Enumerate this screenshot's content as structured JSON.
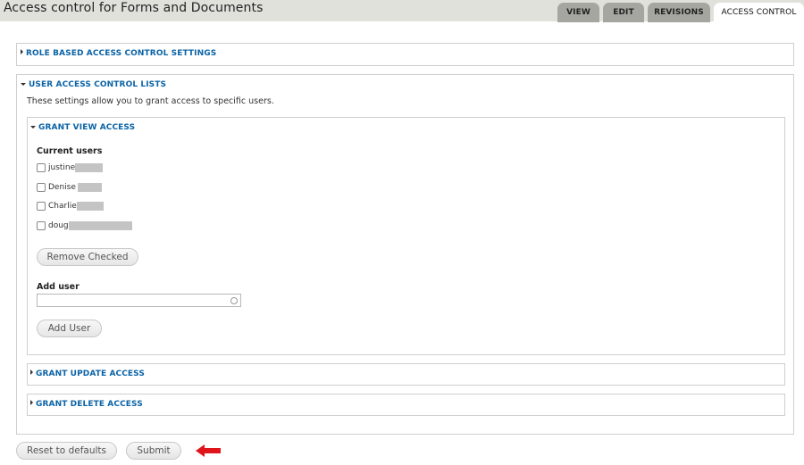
{
  "header": {
    "title": "Access control for Forms and Documents",
    "tabs": [
      {
        "label": "VIEW",
        "active": false
      },
      {
        "label": "EDIT",
        "active": false
      },
      {
        "label": "REVISIONS",
        "active": false
      },
      {
        "label": "ACCESS CONTROL",
        "active": true
      }
    ]
  },
  "role_based": {
    "legend": "ROLE BASED ACCESS CONTROL SETTINGS",
    "expanded": false
  },
  "user_acl": {
    "legend": "USER ACCESS CONTROL LISTS",
    "expanded": true,
    "description": "These settings allow you to grant access to specific users.",
    "grant_view": {
      "legend": "GRANT VIEW ACCESS",
      "expanded": true,
      "current_users_label": "Current users",
      "users": [
        {
          "name": "justine",
          "checked": false,
          "redacted": true
        },
        {
          "name": "Denise",
          "checked": false,
          "redacted": true
        },
        {
          "name": "Charlie",
          "checked": false,
          "redacted": true
        },
        {
          "name": "doug",
          "checked": false,
          "redacted": true
        }
      ],
      "remove_button": "Remove Checked",
      "add_user_label": "Add user",
      "add_user_value": "",
      "add_user_button": "Add User"
    },
    "grant_update": {
      "legend": "GRANT UPDATE ACCESS",
      "expanded": false
    },
    "grant_delete": {
      "legend": "GRANT DELETE ACCESS",
      "expanded": false
    }
  },
  "actions": {
    "reset_button": "Reset to defaults",
    "submit_button": "Submit"
  },
  "colors": {
    "link_blue": "#0a63a6",
    "tab_inactive": "#a6a6a0",
    "header_bg": "#e1e1dc",
    "annotation_arrow": "#e0151b"
  }
}
